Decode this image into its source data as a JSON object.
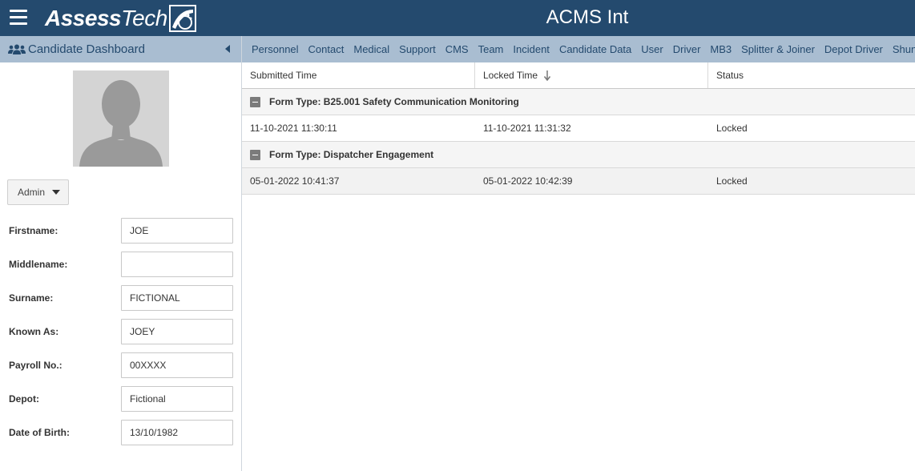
{
  "header": {
    "logo_bold": "Assess",
    "logo_light": "Tech",
    "app_title": "ACMS Int",
    "menu_icon": "hamburger-icon",
    "background": "#244a6e"
  },
  "sidebar": {
    "title": "Candidate Dashboard",
    "title_icon": "users-icon",
    "collapse_icon": "caret-left-icon",
    "avatar_icon": "person-silhouette-icon",
    "admin_label": "Admin",
    "fields": [
      {
        "label": "Firstname:",
        "value": "JOE"
      },
      {
        "label": "Middlename:",
        "value": ""
      },
      {
        "label": "Surname:",
        "value": "FICTIONAL"
      },
      {
        "label": "Known As:",
        "value": "JOEY"
      },
      {
        "label": "Payroll No.:",
        "value": "00XXXX"
      },
      {
        "label": "Depot:",
        "value": "Fictional"
      },
      {
        "label": "Date of Birth:",
        "value": "13/10/1982"
      }
    ]
  },
  "tabs": [
    "Personnel",
    "Contact",
    "Medical",
    "Support",
    "CMS",
    "Team",
    "Incident",
    "Candidate Data",
    "User",
    "Driver",
    "MB3",
    "Splitter & Joiner",
    "Depot Driver",
    "Shunter"
  ],
  "grid": {
    "columns": [
      "Submitted Time",
      "Locked Time",
      "Status"
    ],
    "sort_icon": "sort-descending-icon",
    "groups": [
      {
        "title": "Form Type: B25.001 Safety Communication Monitoring",
        "rows": [
          {
            "submitted": "11-10-2021 11:30:11",
            "locked": "11-10-2021 11:31:32",
            "status": "Locked"
          }
        ]
      },
      {
        "title": "Form Type: Dispatcher Engagement",
        "rows": [
          {
            "submitted": "05-01-2022 10:41:37",
            "locked": "05-01-2022 10:42:39",
            "status": "Locked"
          }
        ]
      }
    ]
  },
  "colors": {
    "accent_bar": "#a9bdd1",
    "accent_text": "#244a6e"
  }
}
